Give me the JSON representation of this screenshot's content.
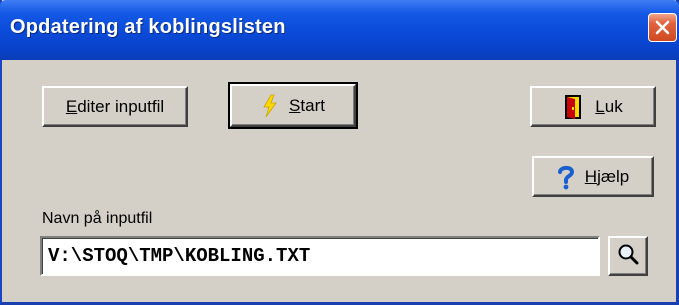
{
  "window": {
    "title": "Opdatering af koblingslisten"
  },
  "buttons": {
    "edit_label_accel": "E",
    "edit_label_rest": "diter inputfil",
    "start_label_accel": "S",
    "start_label_rest": "tart",
    "close_label_accel": "L",
    "close_label_rest": "uk",
    "help_label_accel": "H",
    "help_label_rest": "jælp"
  },
  "input": {
    "label": "Navn på inputfil",
    "value": "V:\\STOQ\\TMP\\KOBLING.TXT"
  },
  "icons": {
    "title_close": "close-icon",
    "start": "lightning-icon",
    "close": "door-exit-icon",
    "help": "question-mark-icon",
    "browse": "magnifier-icon"
  },
  "colors": {
    "titlebar": "#0a4ad8",
    "dialog_background": "#d4d0c8",
    "close_button": "#d04a22",
    "lightning": "#ffd800",
    "help_icon": "#1a5fd0"
  }
}
